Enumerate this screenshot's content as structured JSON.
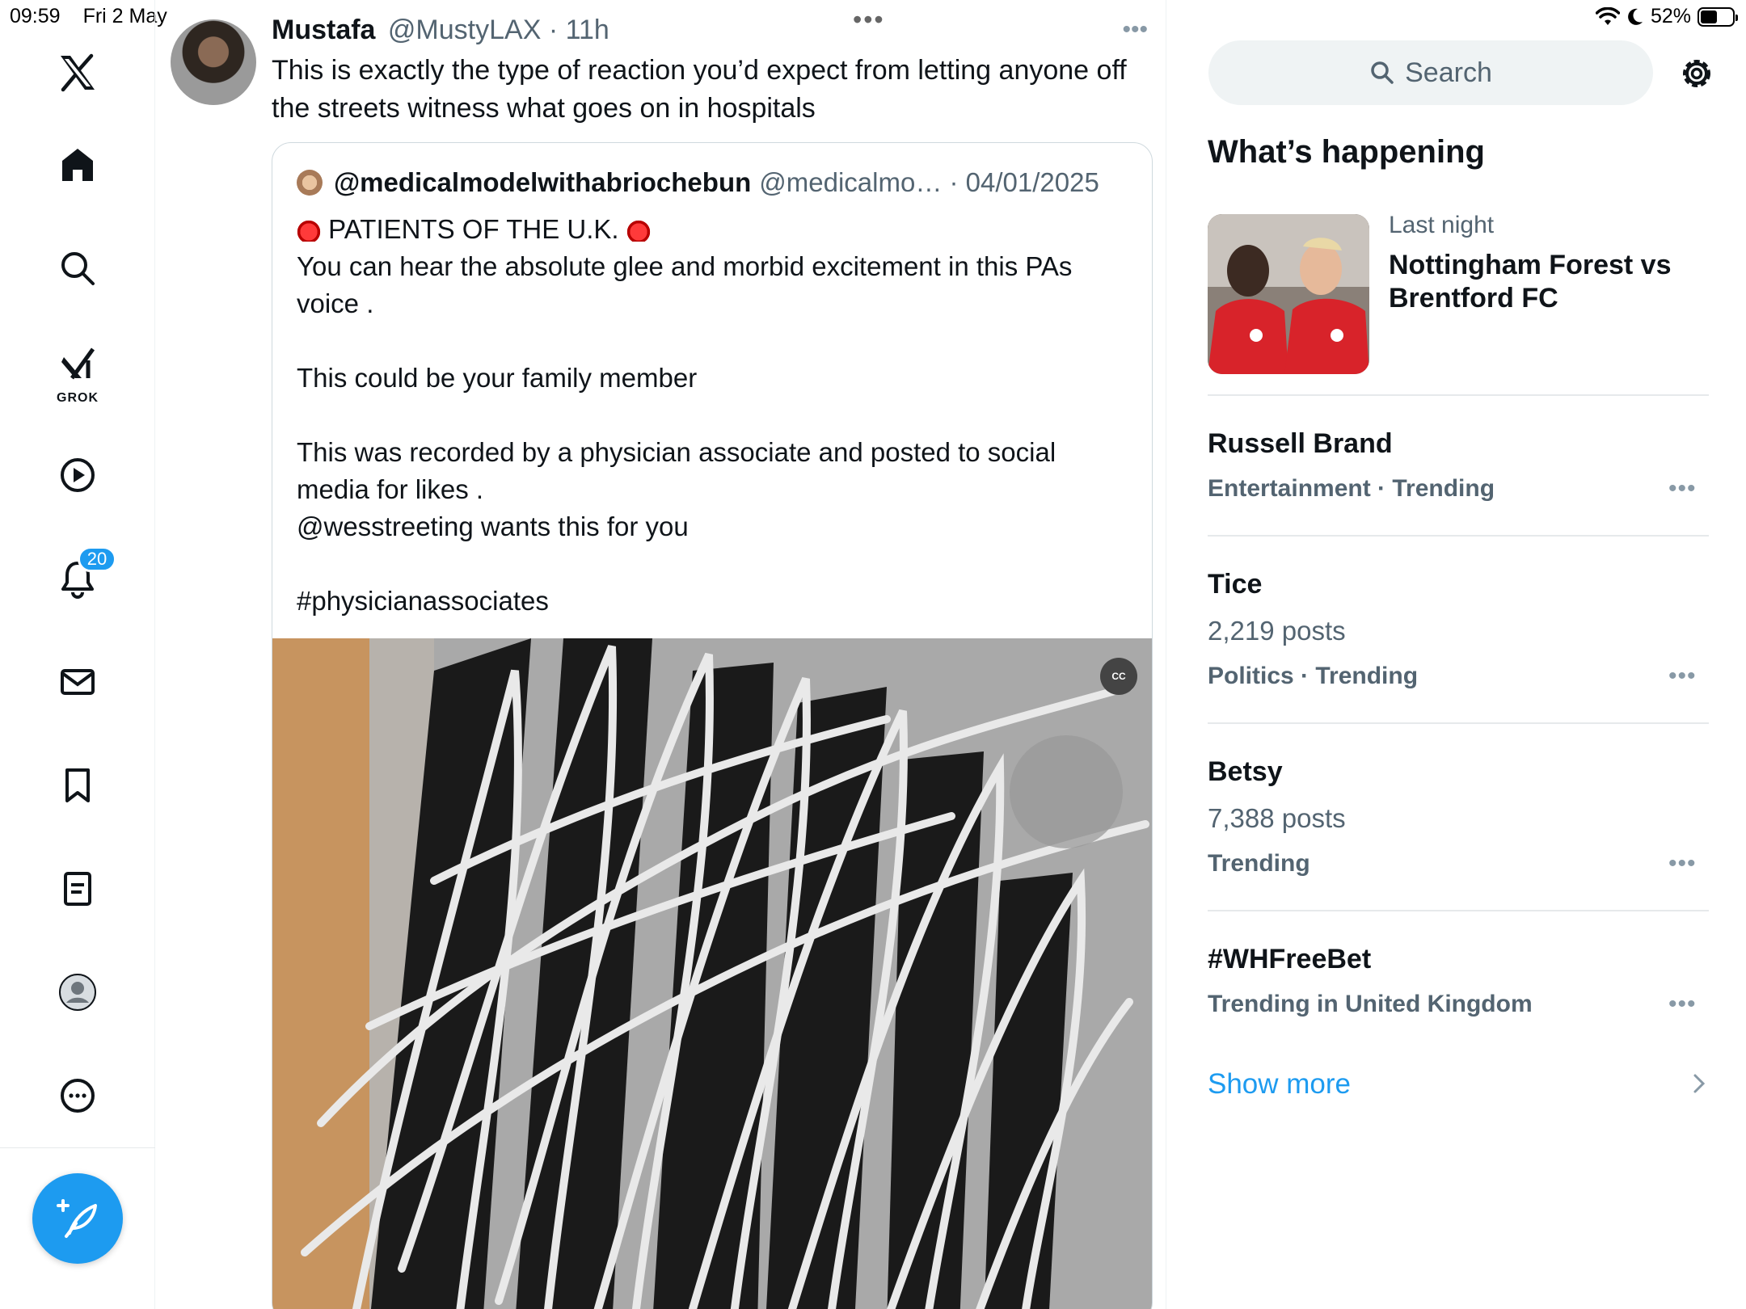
{
  "status_bar": {
    "time": "09:59",
    "date": "Fri 2 May",
    "battery": "52%",
    "battery_level": 0.52
  },
  "nav": {
    "grok_label": "GROK",
    "notifications_count": "20"
  },
  "post": {
    "author_name": "Mustafa",
    "author_meta": "@MustyLAX · 11h",
    "text": "This is exactly the type of reaction you’d expect from letting anyone off the streets witness what goes on in hospitals",
    "quote": {
      "name": "@medicalmodelwithabriochebun",
      "meta": "@medicalmo… · 04/01/2025",
      "headline": "PATIENTS OF THE U.K.",
      "body": "You can hear the absolute glee and morbid excitement in this PAs voice .\n\nThis could be your family member\n\nThis was recorded by a physician associate and posted to social media for likes .\n@wesstreeting wants this for you\n\n#physicianassociates"
    },
    "cc_label": "CC"
  },
  "sidebar": {
    "search_placeholder": "Search",
    "title": "What’s happening",
    "event": {
      "time": "Last night",
      "title": "Nottingham Forest vs Brentford FC"
    },
    "trends": [
      {
        "name": "Russell Brand",
        "posts": "",
        "category": "Entertainment · Trending"
      },
      {
        "name": "Tice",
        "posts": "2,219 posts",
        "category": "Politics · Trending"
      },
      {
        "name": "Betsy",
        "posts": "7,388 posts",
        "category": "Trending"
      },
      {
        "name": "#WHFreeBet",
        "posts": "",
        "category": "Trending in United Kingdom"
      }
    ],
    "show_more": "Show more"
  }
}
